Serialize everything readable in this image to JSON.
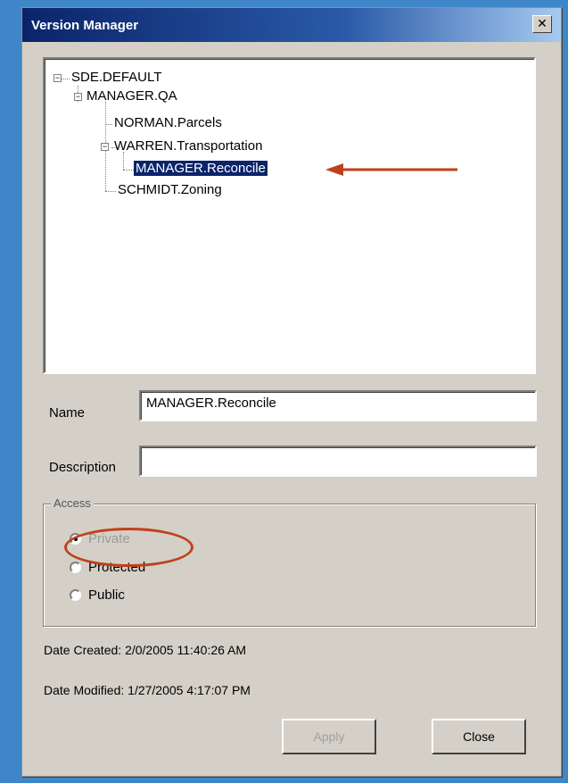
{
  "window": {
    "title": "Version Manager",
    "close_glyph": "✕"
  },
  "tree": {
    "nodes": [
      {
        "label": "SDE.DEFAULT",
        "expander": "−"
      },
      {
        "label": "MANAGER.QA",
        "expander": "−"
      },
      {
        "label": "NORMAN.Parcels"
      },
      {
        "label": "WARREN.Transportation",
        "expander": "−"
      },
      {
        "label": "MANAGER.Reconcile",
        "selected": true
      },
      {
        "label": "SCHMIDT.Zoning"
      }
    ]
  },
  "form": {
    "name_label": "Name",
    "name_value": "MANAGER.Reconcile",
    "description_label": "Description",
    "description_value": ""
  },
  "access": {
    "title": "Access",
    "options": [
      {
        "label": "Private",
        "checked": true,
        "disabled": true
      },
      {
        "label": "Protected",
        "checked": false
      },
      {
        "label": "Public",
        "checked": false
      }
    ]
  },
  "dates": {
    "created_label": "Date Created:",
    "created_value": "2/0/2005 11:40:26 AM",
    "modified_label": "Date Modified:",
    "modified_value": "1/27/2005 4:17:07 PM"
  },
  "buttons": {
    "apply": "Apply",
    "close": "Close"
  },
  "colors": {
    "annotation": "#c0411c",
    "selection": "#0a246a"
  }
}
